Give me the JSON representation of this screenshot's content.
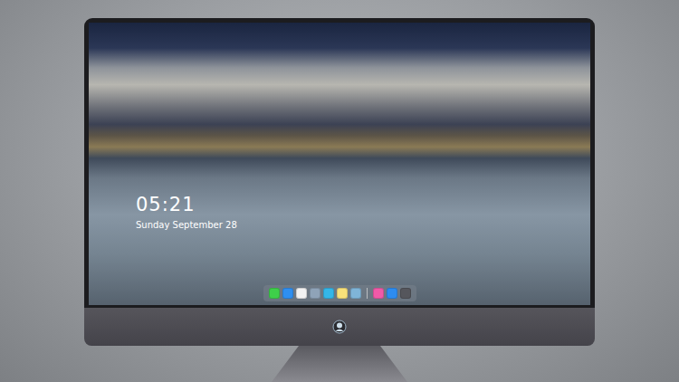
{
  "lock_screen": {
    "time": "05:21",
    "date": "Sunday September 28"
  },
  "dock": {
    "items": [
      {
        "kind": "app",
        "color": "#3ecf4a"
      },
      {
        "kind": "app",
        "color": "#2f8ff0"
      },
      {
        "kind": "app",
        "color": "#f2f2f2"
      },
      {
        "kind": "app",
        "color": "#8fa3b8"
      },
      {
        "kind": "app",
        "color": "#34b6e8"
      },
      {
        "kind": "app",
        "color": "#f7e07a"
      },
      {
        "kind": "app",
        "color": "#7fb4d8"
      },
      {
        "kind": "separator",
        "color": "#dddddd"
      },
      {
        "kind": "app",
        "color": "#f05aa8"
      },
      {
        "kind": "app",
        "color": "#2d8cf0"
      },
      {
        "kind": "app",
        "color": "#55565c"
      }
    ]
  }
}
